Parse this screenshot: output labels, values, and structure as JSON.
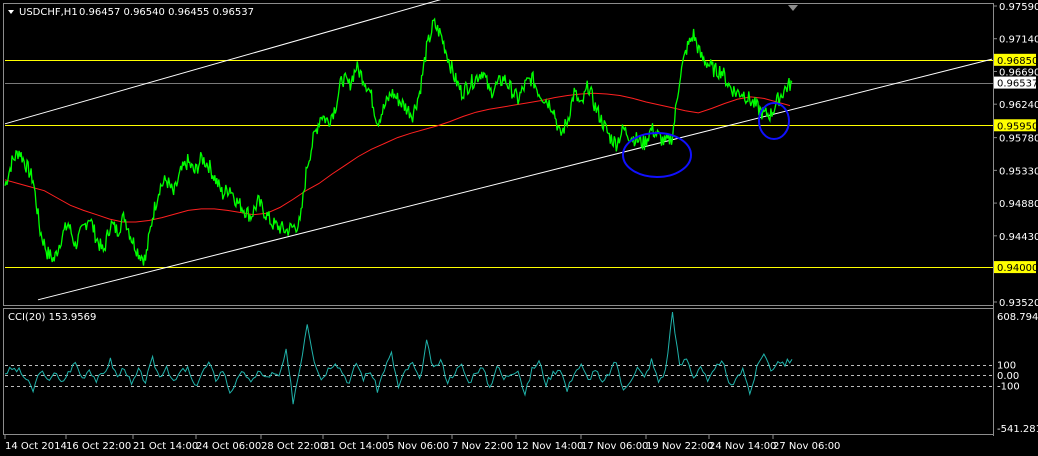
{
  "symbol_header": {
    "symbol": "USDCHF,H1",
    "ohlc": "0.96457 0.96540 0.96455 0.96537"
  },
  "price_axis": {
    "ticks": [
      "0.97590",
      "0.97140",
      "0.96690",
      "0.96240",
      "0.95780",
      "0.95330",
      "0.94880",
      "0.94430",
      "0.93520"
    ],
    "ylim": [
      0.9352,
      0.9759
    ]
  },
  "horizontal_levels": [
    {
      "label": "0.96850",
      "value": 0.9685
    },
    {
      "label": "0.95950",
      "value": 0.9595
    },
    {
      "label": "0.94000",
      "value": 0.94
    }
  ],
  "current_price": {
    "label": "0.96537",
    "value": 0.96537
  },
  "indicator": {
    "title": "CCI(20) 153.9569",
    "scale_labels": [
      "608.7943",
      "100",
      "0.00",
      "-100",
      "-541.2811"
    ],
    "range": [
      -541.2811,
      608.7943
    ],
    "levels": [
      100,
      0,
      -100
    ]
  },
  "time_axis": {
    "labels": [
      "14 Oct 2014",
      "16 Oct 22:00",
      "21 Oct 14:00",
      "24 Oct 06:00",
      "28 Oct 22:00",
      "31 Oct 14:00",
      "5 Nov 06:00",
      "7 Nov 22:00",
      "12 Nov 14:00",
      "17 Nov 06:00",
      "19 Nov 22:00",
      "24 Nov 14:00",
      "27 Nov 06:00"
    ]
  },
  "colors": {
    "background": "#000000",
    "price_line": "#00ff00",
    "moving_average": "#ff2020",
    "level_line": "#ffff00",
    "channel_line": "#ffffff",
    "cci_line": "#20b2aa",
    "annotation_ellipse": "#1010ff",
    "axis_text": "#ffffff",
    "level_label_bg": "#ffff00"
  },
  "chart_data": {
    "type": "line",
    "x": [
      "14 Oct 2014",
      "16 Oct 22:00",
      "21 Oct 14:00",
      "24 Oct 06:00",
      "28 Oct 22:00",
      "31 Oct 14:00",
      "5 Nov 06:00",
      "7 Nov 22:00",
      "12 Nov 14:00",
      "17 Nov 06:00",
      "19 Nov 22:00",
      "24 Nov 14:00",
      "27 Nov 06:00"
    ],
    "price_series": [
      0.9512,
      0.9545,
      0.956,
      0.954,
      0.952,
      0.945,
      0.942,
      0.941,
      0.944,
      0.946,
      0.943,
      0.945,
      0.947,
      0.944,
      0.942,
      0.946,
      0.945,
      0.947,
      0.944,
      0.942,
      0.941,
      0.947,
      0.951,
      0.952,
      0.95,
      0.953,
      0.9545,
      0.953,
      0.955,
      0.954,
      0.952,
      0.95,
      0.951,
      0.949,
      0.948,
      0.947,
      0.949,
      0.9475,
      0.946,
      0.9455,
      0.945,
      0.9455,
      0.946,
      0.954,
      0.958,
      0.961,
      0.96,
      0.962,
      0.966,
      0.965,
      0.9675,
      0.966,
      0.964,
      0.96,
      0.962,
      0.964,
      0.963,
      0.962,
      0.961,
      0.964,
      0.97,
      0.9735,
      0.972,
      0.969,
      0.966,
      0.964,
      0.965,
      0.966,
      0.967,
      0.964,
      0.965,
      0.966,
      0.9645,
      0.963,
      0.965,
      0.966,
      0.964,
      0.963,
      0.962,
      0.958,
      0.96,
      0.964,
      0.962,
      0.965,
      0.962,
      0.96,
      0.958,
      0.957,
      0.959,
      0.958,
      0.9575,
      0.957,
      0.959,
      0.958,
      0.957,
      0.958,
      0.966,
      0.97,
      0.972,
      0.969,
      0.968,
      0.967,
      0.967,
      0.965,
      0.964,
      0.964,
      0.963,
      0.962,
      0.961,
      0.961,
      0.963,
      0.9645,
      0.9654
    ],
    "moving_average_series": [
      0.952,
      0.9515,
      0.951,
      0.9505,
      0.9495,
      0.9485,
      0.9478,
      0.9472,
      0.9466,
      0.9462,
      0.9462,
      0.9464,
      0.9468,
      0.9473,
      0.9478,
      0.948,
      0.948,
      0.9478,
      0.9475,
      0.9472,
      0.9474,
      0.9482,
      0.9493,
      0.9505,
      0.9515,
      0.9528,
      0.954,
      0.9552,
      0.9562,
      0.957,
      0.9578,
      0.9584,
      0.9589,
      0.9594,
      0.96,
      0.9607,
      0.9613,
      0.9617,
      0.962,
      0.9623,
      0.9626,
      0.9629,
      0.9633,
      0.9636,
      0.9638,
      0.9639,
      0.9638,
      0.9636,
      0.9632,
      0.9627,
      0.9623,
      0.9619,
      0.9615,
      0.9612,
      0.9618,
      0.9625,
      0.9631,
      0.9634,
      0.9632,
      0.9627,
      0.9622
    ],
    "cci_series": [
      20,
      60,
      40,
      -40,
      -150,
      50,
      -60,
      30,
      -80,
      20,
      120,
      -30,
      60,
      -50,
      10,
      140,
      -20,
      80,
      -100,
      40,
      -60,
      150,
      -20,
      90,
      -80,
      30,
      60,
      -120,
      20,
      110,
      -40,
      50,
      -160,
      -60,
      40,
      -90,
      50,
      -30,
      10,
      -20,
      220,
      -250,
      80,
      500,
      150,
      -40,
      60,
      130,
      30,
      -80,
      120,
      -30,
      40,
      -140,
      60,
      200,
      -120,
      40,
      110,
      -60,
      310,
      50,
      140,
      -60,
      30,
      90,
      -80,
      40,
      60,
      -120,
      90,
      -40,
      20,
      60,
      -190,
      50,
      130,
      -80,
      20,
      70,
      -150,
      30,
      90,
      -50,
      60,
      -90,
      20,
      130,
      -160,
      -40,
      70,
      -30,
      140,
      -60,
      40,
      600,
      80,
      160,
      -20,
      90,
      -70,
      40,
      160,
      -100,
      -60,
      80,
      -180,
      60,
      220,
      40,
      140,
      110,
      150
    ],
    "ylim": [
      0.9352,
      0.9759
    ],
    "channel": {
      "upper": {
        "start": 0.9597,
        "end": 0.9795
      },
      "lower": {
        "start": 0.9355,
        "end": 0.9686
      }
    },
    "grid": false,
    "legend": "none"
  }
}
